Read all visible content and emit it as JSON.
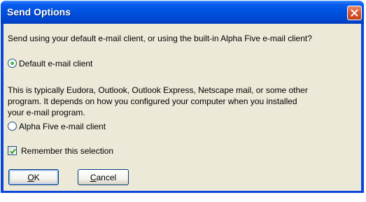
{
  "window": {
    "title": "Send Options"
  },
  "prompt": "Send using your default e-mail client, or using the built-in Alpha Five e-mail client?",
  "options": [
    {
      "label": "Default e-mail client",
      "selected": true,
      "description_lines": [
        "This is typically Eudora, Outlook, Outlook Express, Netscape mail, or some other",
        "program. It depends on how you configured your computer when you installed",
        "your e-mail program."
      ]
    },
    {
      "label": "Alpha Five e-mail client",
      "selected": false
    }
  ],
  "remember": {
    "label": "Remember this selection",
    "checked": true
  },
  "buttons": {
    "ok": {
      "mnemonic": "O",
      "rest": "K"
    },
    "cancel": {
      "mnemonic": "C",
      "rest": "ancel"
    }
  },
  "colors": {
    "titlebar": "#0054e3",
    "client_bg": "#ece9d8",
    "close_button": "#d7552d"
  }
}
